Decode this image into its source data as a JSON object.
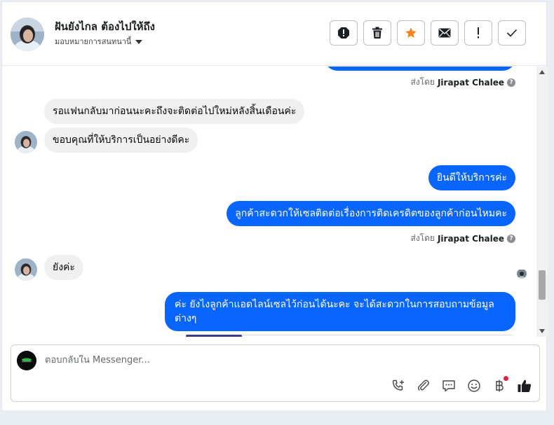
{
  "header": {
    "contact_name": "ฝันยังไกล ต้องไปให้ถึง",
    "assign_label": "มอบหมายการสนทนานี้",
    "actions": [
      "spam-icon",
      "trash-icon",
      "star-icon",
      "envelope-icon",
      "exclamation-icon",
      "check-icon"
    ]
  },
  "messages": {
    "sent_by_prefix": "ส่งโดย",
    "sent_by_name": "Jirapat Chalee",
    "m1": "รอแฟนกลับมาก่อนนะคะถึงจะติดต่อไปใหม่หลังสิ้นเดือนค่ะ",
    "m2": "ขอบคุณที่ให้บริการเป็นอย่างดีคะ",
    "m3": "ยินดีให้บริการค่ะ",
    "m4": "ลูกค้าสะดวกให้เซลติดต่อเรื่องการติดเครดิตของลูกค้าก่อนไหมคะ",
    "m5": "ยังค่ะ",
    "m6": "ค่ะ ยังไงลูกค้าแอดไลน์เซลไว้ก่อนได้นะคะ จะได้สะดวกในการสอบถามข้อมูลต่างๆ"
  },
  "composer": {
    "placeholder": "ตอบกลับใน Messenger...",
    "value": ""
  },
  "colors": {
    "outgoing_bubble": "#0866ff",
    "incoming_bubble": "#f0f0f0",
    "star": "#f5821f",
    "notification_dot": "#e41e3f"
  }
}
